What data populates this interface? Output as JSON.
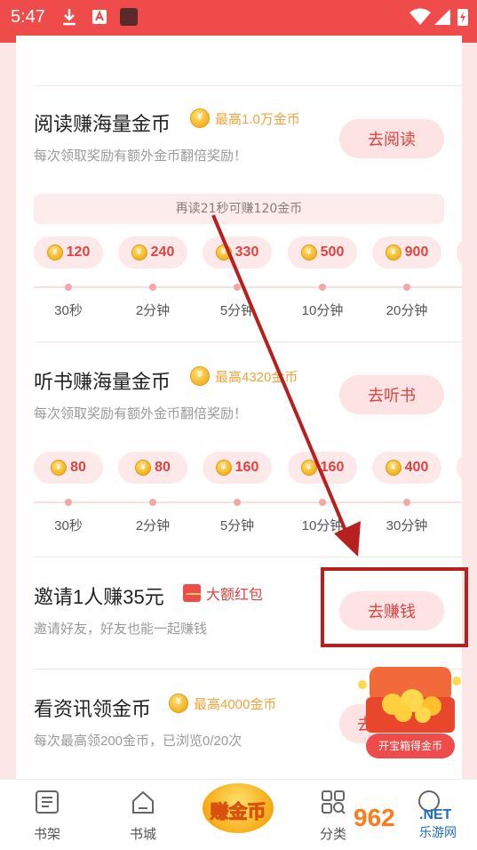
{
  "status_bar": {
    "time": "5:47"
  },
  "reading": {
    "title": "阅读赚海量金币",
    "max_label": "最高1.0万金币",
    "description": "每次领取奖励有额外金币翻倍奖励！",
    "button": "去阅读",
    "progress_hint": "再读21秒可赚120金币",
    "rewards": [
      {
        "amount": "120",
        "time": "30秒"
      },
      {
        "amount": "240",
        "time": "2分钟"
      },
      {
        "amount": "330",
        "time": "5分钟"
      },
      {
        "amount": "500",
        "time": "10分钟"
      },
      {
        "amount": "900",
        "time": "20分钟"
      }
    ]
  },
  "listening": {
    "title": "听书赚海量金币",
    "max_label": "最高4320金币",
    "description": "每次领取奖励有额外金币翻倍奖励！",
    "button": "去听书",
    "rewards": [
      {
        "amount": "80",
        "time": "30秒"
      },
      {
        "amount": "80",
        "time": "2分钟"
      },
      {
        "amount": "160",
        "time": "5分钟"
      },
      {
        "amount": "160",
        "time": "10分钟"
      },
      {
        "amount": "400",
        "time": "30分钟"
      }
    ]
  },
  "invite": {
    "title": "邀请1人赚35元",
    "badge": "大额红包",
    "description": "邀请好友，好友也能一起赚钱",
    "button": "去赚钱"
  },
  "news": {
    "title": "看资讯领金币",
    "max_label": "最高4000金币",
    "description": "每次最高领200金币，已浏览0/20次",
    "button": "去"
  },
  "treasure": {
    "label": "开宝箱得金币"
  },
  "tabbar": {
    "bookshelf": "书架",
    "bookcity": "书城",
    "earn": "赚金币",
    "category": "分类"
  },
  "watermark": {
    "big": "962",
    "net": ".NET",
    "site": "乐游网"
  },
  "colors": {
    "accent": "#f04b4b",
    "coin": "#f3b21f",
    "annotation": "#b81f1f"
  }
}
